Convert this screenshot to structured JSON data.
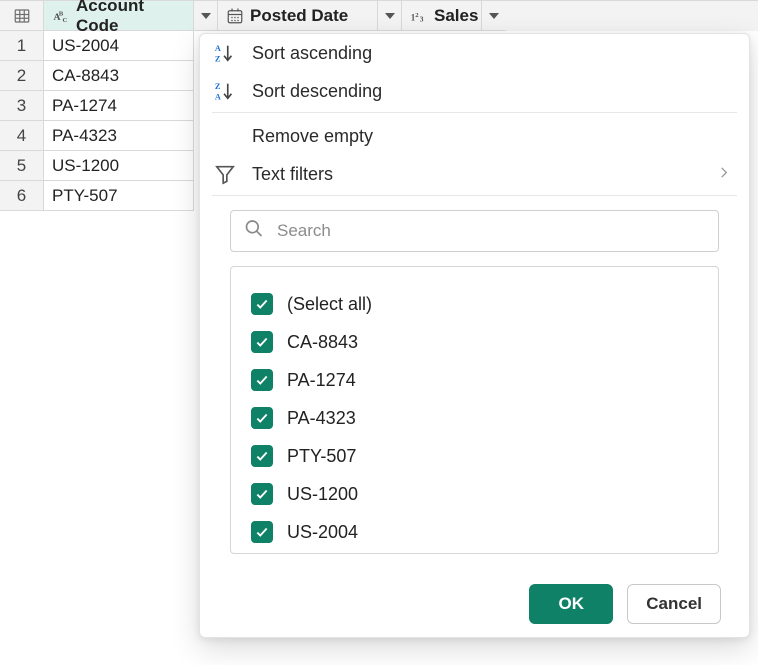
{
  "columns": {
    "account": {
      "label": "Account Code"
    },
    "posted": {
      "label": "Posted Date"
    },
    "sales": {
      "label": "Sales"
    }
  },
  "rows": [
    {
      "idx": "1",
      "account": "US-2004"
    },
    {
      "idx": "2",
      "account": "CA-8843"
    },
    {
      "idx": "3",
      "account": "PA-1274"
    },
    {
      "idx": "4",
      "account": "PA-4323"
    },
    {
      "idx": "5",
      "account": "US-1200"
    },
    {
      "idx": "6",
      "account": "PTY-507"
    }
  ],
  "menu": {
    "sort_asc": "Sort ascending",
    "sort_desc": "Sort descending",
    "remove_empty": "Remove empty",
    "text_filters": "Text filters"
  },
  "search": {
    "placeholder": "Search"
  },
  "filter_items": [
    {
      "label": "(Select all)"
    },
    {
      "label": "CA-8843"
    },
    {
      "label": "PA-1274"
    },
    {
      "label": "PA-4323"
    },
    {
      "label": "PTY-507"
    },
    {
      "label": "US-1200"
    },
    {
      "label": "US-2004"
    }
  ],
  "buttons": {
    "ok": "OK",
    "cancel": "Cancel"
  }
}
